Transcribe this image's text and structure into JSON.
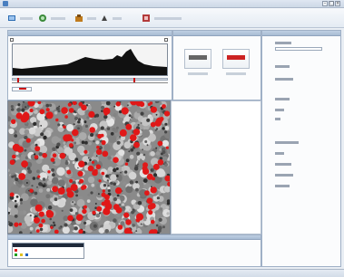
{
  "window": {
    "title": "",
    "controls": [
      "minimize-icon",
      "maximize-icon",
      "close-icon"
    ]
  },
  "toolbar": {
    "buttons": [
      {
        "icon": "open-image-icon",
        "label": "",
        "color": "#2d6db3"
      },
      {
        "icon": "detect-cells-icon",
        "label": "",
        "color": "#3a8a3a"
      },
      {
        "icon": "settings-icon",
        "label": "",
        "color": "#c07b1d"
      },
      {
        "icon": "export-icon",
        "label": "",
        "color": "#444444"
      },
      {
        "icon": "report-icon",
        "label": "",
        "color": "#b33a3a"
      }
    ]
  },
  "histogram_panel": {
    "title": "",
    "marker_color": "#cc1111"
  },
  "preview_panel": {
    "title": "",
    "thumbnails": [
      {
        "name": "thumb-original",
        "bar_color": "#666666"
      },
      {
        "name": "thumb-threshold",
        "bar_color": "#cc2222"
      }
    ]
  },
  "image_panel": {
    "overlay_color": "#e01818",
    "background": "#8a8a8a"
  },
  "right_panel": {
    "title": "",
    "items": [
      "",
      "",
      "",
      "",
      "",
      "",
      "",
      "",
      ""
    ]
  },
  "bottom_panel": {
    "legend_colors": [
      "#e02020",
      "#20a020",
      "#e0c020",
      "#2060c0"
    ]
  }
}
